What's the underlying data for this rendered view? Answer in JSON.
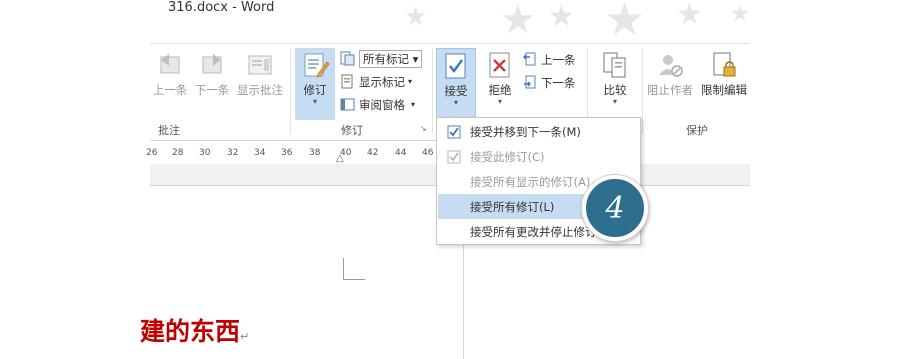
{
  "window": {
    "title": "316.docx - Word"
  },
  "ribbon": {
    "comments": {
      "label": "批注",
      "prev_label": "上一条",
      "next_label": "下一条",
      "show_label": "显示批注"
    },
    "tracking": {
      "label": "修订",
      "track_label": "修订",
      "markup_select": "所有标记",
      "show_markup_label": "显示标记",
      "review_pane_label": "审阅窗格"
    },
    "changes": {
      "accept_label": "接受",
      "reject_label": "拒绝",
      "prev_label": "上一条",
      "next_label": "下一条"
    },
    "compare": {
      "compare_label": "比较"
    },
    "protect": {
      "label": "保护",
      "block_authors_label": "阻止作者",
      "restrict_label": "限制编辑"
    }
  },
  "ruler": {
    "ticks": [
      "26",
      "28",
      "30",
      "32",
      "34",
      "36",
      "38",
      "40",
      "42",
      "44",
      "46"
    ]
  },
  "accept_menu": {
    "items": [
      {
        "label": "接受并移到下一条(M)",
        "enabled": true,
        "icon": "accept-move-icon"
      },
      {
        "label": "接受此修订(C)",
        "enabled": false,
        "icon": "accept-this-icon"
      },
      {
        "label": "接受所有显示的修订(A)",
        "enabled": false,
        "icon": ""
      },
      {
        "label": "接受所有修订(L)",
        "enabled": true,
        "icon": "",
        "highlighted": true
      },
      {
        "label": "接受所有更改并停止修订",
        "enabled": true,
        "icon": ""
      }
    ]
  },
  "document": {
    "heading_fragment": "建的东西",
    "paragraph_mark": "↵"
  },
  "step_badge": "4",
  "colors": {
    "accent": "#c5dcf2",
    "badge": "#2e6f8f",
    "doc_text": "#c00000"
  }
}
